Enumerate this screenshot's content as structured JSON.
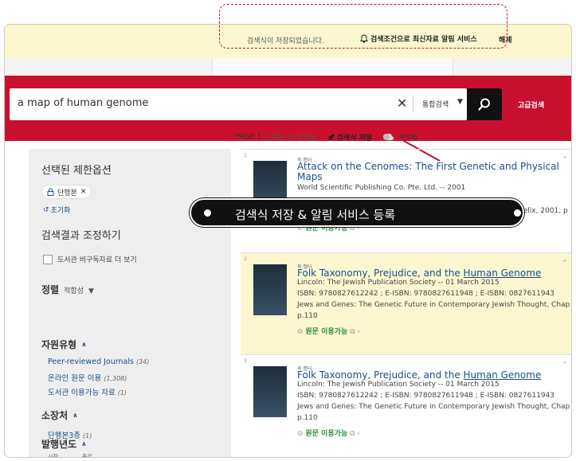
{
  "notify": {
    "message": "검색식이 저장되었습니다.",
    "alert_label": "검색조건으로 최신자료 알림 서비스",
    "unsubscribe": "해제"
  },
  "search": {
    "query": "a map of human genome",
    "scope": "통합검색",
    "advanced": "고급검색"
  },
  "results_bar": {
    "page": "PAGE 1",
    "count": "1,309 건 검색됨",
    "save_label": "검색식 저장",
    "personalize": "개인화"
  },
  "sidebar": {
    "selected_title": "선택된 제한옵션",
    "chip": "단행본",
    "reset": "초기화",
    "adjust_title": "검색결과 조정하기",
    "checkbox_label": "도서관 비구독자료 더 보기",
    "sort_label": "정렬",
    "sort_value": "적합성",
    "resource_type": "자원유형",
    "resource_items": [
      {
        "label": "Peer-reviewed Journals",
        "count": "(34)"
      },
      {
        "label": "온라인 원문 이용",
        "count": "(1,308)"
      },
      {
        "label": "도서관 이용가능 자료",
        "count": "(1)"
      }
    ],
    "holdings": "소장처",
    "holdings_items": [
      {
        "label": "단행본3층",
        "count": "(1)"
      }
    ],
    "pub_year": "발행년도",
    "range_from": "시작",
    "range_to": "종료"
  },
  "results": [
    {
      "num": "1",
      "type": "북 챕터",
      "title": "Attack on the Cenomes: The First Genetic and Physical Maps",
      "meta1": "World Scientific Publishing Co. Pte. Ltd. -- 2001",
      "meta2": "Helix, 2001, p",
      "link": "원문 이용가능"
    },
    {
      "num": "2",
      "type": "북 챕터",
      "title_pre": "Folk Taxonomy, Prejudice, and the ",
      "title_hl": "Human Genome",
      "meta1": "Lincoln: The Jewish Publication Society -- 01 March 2015",
      "meta2": "ISBN: 9780827612242 ; E-ISBN: 9780827611948 ; E-ISBN: 0827611943",
      "meta3": "Jews and Genes: The Genetic Future in Contemporary Jewish Thought, Chap",
      "meta4": "p.110",
      "link": "원문 이용가능"
    },
    {
      "num": "3",
      "type": "북 챕터",
      "title_pre": "Folk Taxonomy, Prejudice, and the ",
      "title_hl": "Human Genome",
      "meta1": "Lincoln: The Jewish Publication Society -- 01 March 2015",
      "meta2": "ISBN: 9780827612242 ; E-ISBN: 9780827611948 ; E-ISBN: 0827611943",
      "meta3": "Jews and Genes: The Genetic Future in Contemporary Jewish Thought, Chap",
      "meta4": "p.110",
      "link": "원문 이용가능"
    }
  ],
  "callout": {
    "text": "검색식 저장 & 알림 서비스 등록"
  },
  "colors": {
    "brand": "#c8102e",
    "highlight": "#fcf7cf",
    "link": "#1a4e8a",
    "available": "#2e8b3a"
  }
}
